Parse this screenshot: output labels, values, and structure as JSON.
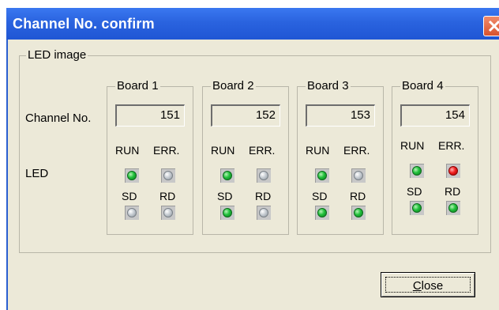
{
  "window": {
    "title": "Channel No. confirm",
    "group_label": "LED image",
    "row_labels": {
      "channel": "Channel No.",
      "led": "LED"
    },
    "led_labels": {
      "run": "RUN",
      "err": "ERR.",
      "sd": "SD",
      "rd": "RD"
    },
    "boards": [
      {
        "name": "Board 1",
        "channel": "151",
        "leds": {
          "run": "green",
          "err": "off",
          "sd": "off",
          "rd": "off"
        }
      },
      {
        "name": "Board 2",
        "channel": "152",
        "leds": {
          "run": "green",
          "err": "off",
          "sd": "green",
          "rd": "off"
        }
      },
      {
        "name": "Board 3",
        "channel": "153",
        "leds": {
          "run": "green",
          "err": "off",
          "sd": "green",
          "rd": "green"
        }
      },
      {
        "name": "Board 4",
        "channel": "154",
        "leds": {
          "run": "green",
          "err": "red",
          "sd": "green",
          "rd": "green"
        }
      }
    ],
    "close_button": {
      "mnemonic": "C",
      "rest": "lose"
    }
  },
  "colors": {
    "title_bar": "#2a63df",
    "led_green": "#20c03a",
    "led_red": "#f02020",
    "led_off": "#c6ccd2"
  }
}
